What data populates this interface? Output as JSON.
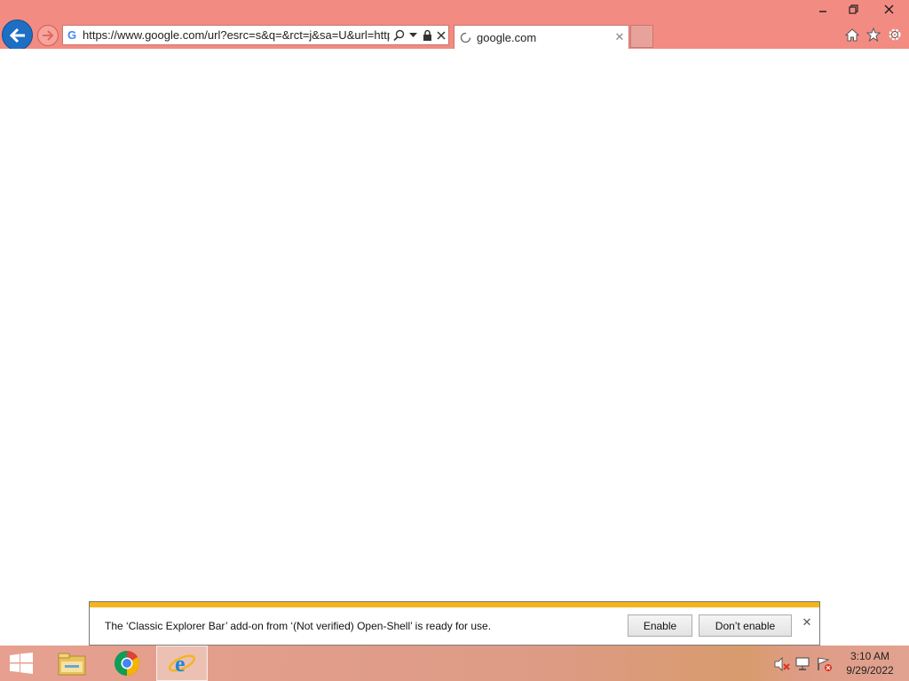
{
  "window": {
    "minimize_icon": "minimize-icon",
    "restore_icon": "restore-icon",
    "close_icon": "close-icon"
  },
  "browser": {
    "address_text": "https://www.google.com/url?esrc=s&q=&rct=j&sa=U&url=http",
    "site_icon_text": "G",
    "tab_title": "google.com",
    "colors": {
      "chrome_bg": "#f28b82",
      "back_button": "#1e6fc4"
    }
  },
  "notification": {
    "message": "The ‘Classic Explorer Bar’ add-on from ‘(Not verified) Open-Shell’ is ready for use.",
    "enable_label": "Enable",
    "dont_enable_label": "Don’t enable",
    "accent_color": "#f2b51d"
  },
  "taskbar": {
    "apps": [
      "file-explorer-icon",
      "chrome-icon",
      "internet-explorer-icon"
    ],
    "active_app": "internet-explorer-icon",
    "tray_icons": [
      "volume-muted-icon",
      "network-icon",
      "action-center-flag-icon"
    ],
    "clock_time": "3:10 AM",
    "clock_date": "9/29/2022"
  }
}
